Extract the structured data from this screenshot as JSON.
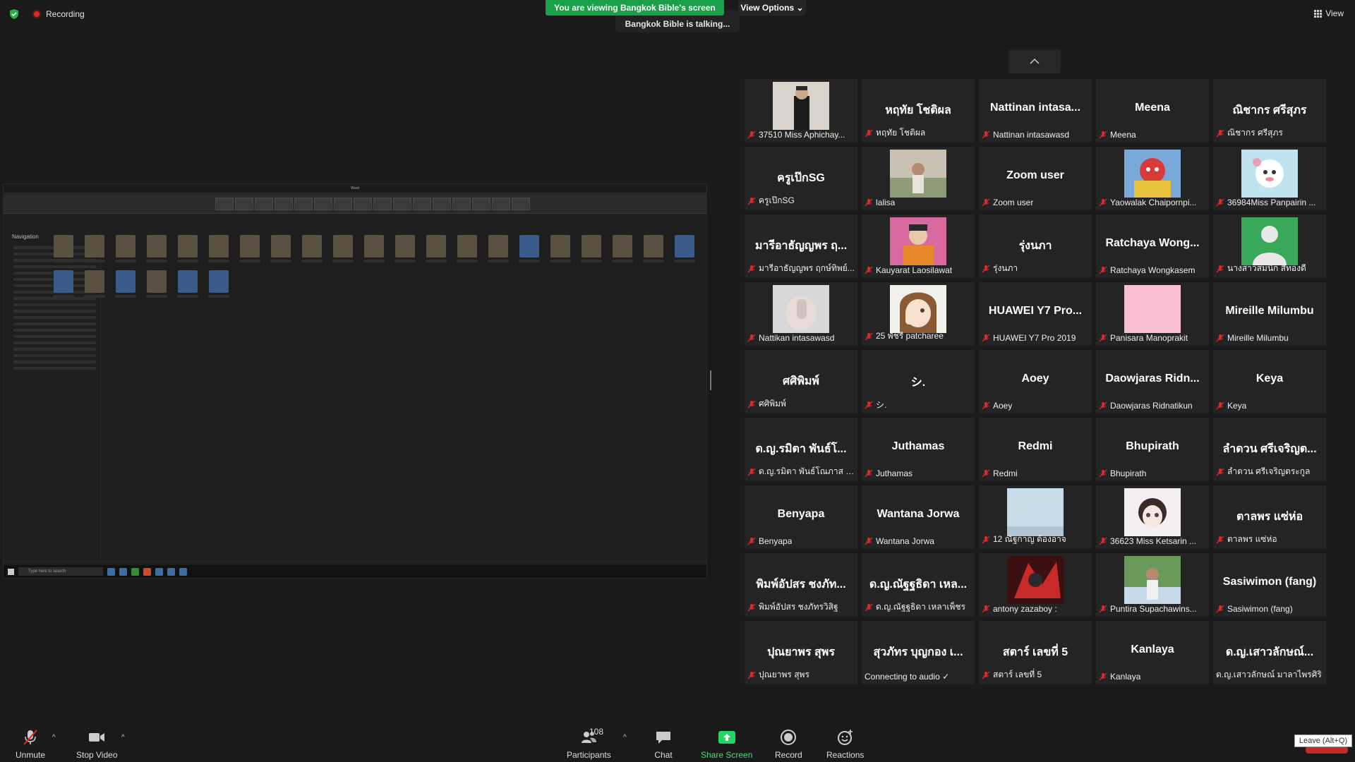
{
  "header": {
    "recording": "Recording",
    "viewing_banner": "You are viewing Bangkok Bible's screen",
    "view_options": "View Options",
    "talking": "Bangkok Bible is talking...",
    "view_button": "View"
  },
  "shared_screen": {
    "app_title": "Word",
    "nav_label": "Navigation",
    "taskbar_search": "Type here to search"
  },
  "participants": [
    {
      "big": "",
      "name": "37510 Miss Aphichay...",
      "photo": "man-dark"
    },
    {
      "big": "หฤทัย โชติผล",
      "name": "หฤทัย โชติผล"
    },
    {
      "big": "Nattinan intasa...",
      "name": "Nattinan intasawasd"
    },
    {
      "big": "Meena",
      "name": "Meena"
    },
    {
      "big": "ณิชากร ศรีสุภร",
      "name": "ณิชากร ศรีสุภร"
    },
    {
      "big": "ครูเป๊กSG",
      "name": "ครูเป๊กSG"
    },
    {
      "big": "",
      "name": "lalisa",
      "photo": "outdoor"
    },
    {
      "big": "Zoom user",
      "name": "Zoom user"
    },
    {
      "big": "",
      "name": "Yaowalak Chaipornpi...",
      "photo": "cartoon"
    },
    {
      "big": "",
      "name": "36984Miss Panpairin ...",
      "photo": "cute"
    },
    {
      "big": "มารีอาธัญญพร ฤ...",
      "name": "มารีอาธัญญพร ฤกษ์ทิพย์..."
    },
    {
      "big": "",
      "name": "Kauyarat Laosilawat",
      "photo": "colorful"
    },
    {
      "big": "รุ่งนภา",
      "name": "รุ่งนภา"
    },
    {
      "big": "Ratchaya Wong...",
      "name": "Ratchaya Wongkasem"
    },
    {
      "big": "",
      "name": "นางสาวสมนึก สีทองดี",
      "photo": "avatar"
    },
    {
      "big": "",
      "name": "Nattikan intasawasd",
      "photo": "hand"
    },
    {
      "big": "",
      "name": "25 พัชรี patcharee",
      "photo": "anime"
    },
    {
      "big": "HUAWEI Y7 Pro...",
      "name": "HUAWEI Y7 Pro 2019"
    },
    {
      "big": "",
      "name": "Panisara Manoprakit",
      "photo": "pink"
    },
    {
      "big": "Mireille Milumbu",
      "name": "Mireille Milumbu"
    },
    {
      "big": "ศศิพิมพ์",
      "name": "ศศิพิมพ์"
    },
    {
      "big": "シ.",
      "name": "シ."
    },
    {
      "big": "Aoey",
      "name": "Aoey"
    },
    {
      "big": "Daowjaras Ridn...",
      "name": "Daowjaras Ridnatikun"
    },
    {
      "big": "Keya",
      "name": "Keya"
    },
    {
      "big": "ด.ญ.รมิตา พันธ์โ...",
      "name": "ด.ญ.รมิตา พันธ์โณภาส เ..."
    },
    {
      "big": "Juthamas",
      "name": "Juthamas"
    },
    {
      "big": "Redmi",
      "name": "Redmi"
    },
    {
      "big": "Bhupirath",
      "name": "Bhupirath"
    },
    {
      "big": "ลำดวน ศรีเจริญต...",
      "name": "ลำดวน ศรีเจริญตระกูล"
    },
    {
      "big": "Benyapa",
      "name": "Benyapa"
    },
    {
      "big": "Wantana Jorwa",
      "name": "Wantana Jorwa"
    },
    {
      "big": "",
      "name": "12 ณัฐกาญ ต้องอาจ",
      "photo": "sky"
    },
    {
      "big": "",
      "name": "36623 Miss Ketsarin ...",
      "photo": "girl"
    },
    {
      "big": "ตาลพร แซ่ห่อ",
      "name": "ตาลพร แซ่ห่อ"
    },
    {
      "big": "พิมพ์อัปสร ชงภัท...",
      "name": "พิมพ์อัปสร ชงภัทรวิสิฐ"
    },
    {
      "big": "ด.ญ.ณัฐฐธิดา เหล...",
      "name": "ด.ญ.ณัฐฐธิดา เหลาเพ็ชร"
    },
    {
      "big": "",
      "name": "antony zazaboy :",
      "photo": "red"
    },
    {
      "big": "",
      "name": "Puntira Supachawins...",
      "photo": "nature"
    },
    {
      "big": "Sasiwimon (fang)",
      "name": "Sasiwimon (fang)"
    },
    {
      "big": "ปุณยาพร สุพร",
      "name": "ปุณยาพร สุพร"
    },
    {
      "big": "สุวภัทร บุญกอง เ...",
      "name": "Connecting to audio ✓",
      "no_mic": true
    },
    {
      "big": "สตาร์ เลขที่ 5",
      "name": "สตาร์ เลขที่ 5"
    },
    {
      "big": "Kanlaya",
      "name": "Kanlaya"
    },
    {
      "big": "ด.ญ.เสาวลักษณ์...",
      "name": "ด.ญ.เสาวลักษณ์ มาลาไพรศิริ",
      "no_mic": true
    }
  ],
  "toolbar": {
    "unmute": "Unmute",
    "stop_video": "Stop Video",
    "participants": "Participants",
    "participant_count": "108",
    "chat": "Chat",
    "share_screen": "Share Screen",
    "record": "Record",
    "reactions": "Reactions",
    "leave_tooltip": "Leave (Alt+Q)"
  },
  "colors": {
    "banner_green": "#1aa048",
    "share_green": "#25d366",
    "record_red": "#e02828",
    "mic_red": "#e02828"
  }
}
